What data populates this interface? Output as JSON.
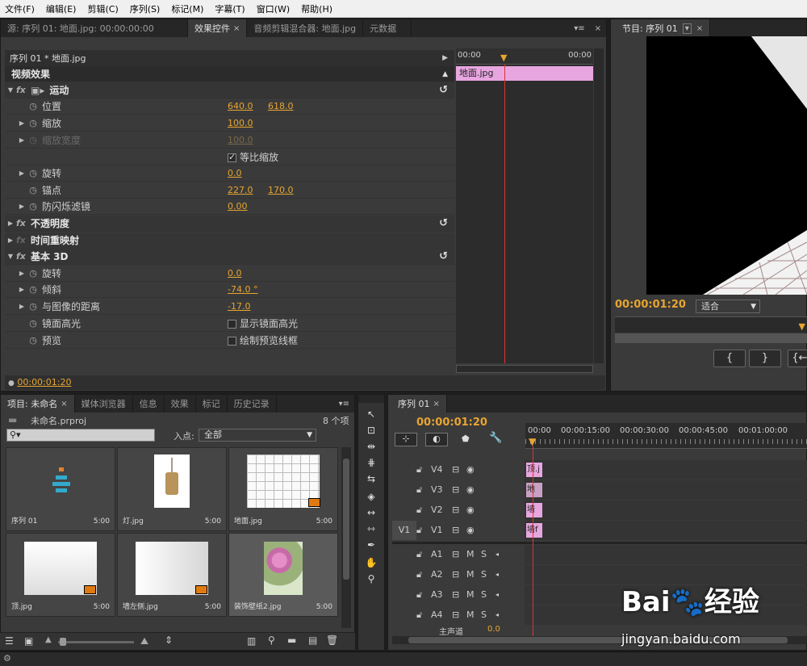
{
  "menu": [
    "文件(F)",
    "编辑(E)",
    "剪辑(C)",
    "序列(S)",
    "标记(M)",
    "字幕(T)",
    "窗口(W)",
    "帮助(H)"
  ],
  "top_tabs": {
    "source": "源: 序列 01: 地面.jpg: 00:00:00:00",
    "effect_controls": "效果控件",
    "audio_mixer": "音频剪辑混合器: 地面.jpg",
    "metadata": "元数据"
  },
  "effect_controls": {
    "clip_header": "序列 01 * 地面.jpg",
    "video_effects": "视频效果",
    "motion": "运动",
    "position_label": "位置",
    "position_x": "640.0",
    "position_y": "618.0",
    "scale_label": "缩放",
    "scale_value": "100.0",
    "scale_width_label": "缩放宽度",
    "scale_width_value": "100.0",
    "uniform_scale_label": "等比缩放",
    "rotation_label": "旋转",
    "rotation_value": "0.0",
    "anchor_label": "锚点",
    "anchor_x": "227.0",
    "anchor_y": "170.0",
    "antiflicker_label": "防闪烁滤镜",
    "antiflicker_value": "0.00",
    "opacity": "不透明度",
    "time_remap": "时间重映射",
    "basic3d": "基本 3D",
    "b3d_rotation_label": "旋转",
    "b3d_rotation_value": "0.0",
    "tilt_label": "倾斜",
    "tilt_value": "-74.0 °",
    "distance_label": "与图像的距离",
    "distance_value": "-17.0",
    "specular_label": "镜面高光",
    "specular_check": "显示镜面高光",
    "preview_label": "预览",
    "preview_check": "绘制预览线框",
    "ruler_start": "00:00",
    "ruler_end": "00:00",
    "clip_name": "地面.jpg",
    "timecode": "00:00:01:20"
  },
  "program": {
    "tab": "节目: 序列 01",
    "timecode": "00:00:01:20",
    "fit": "适合"
  },
  "project": {
    "tabs": [
      "项目: 未命名",
      "媒体浏览器",
      "信息",
      "效果",
      "标记",
      "历史记录"
    ],
    "file": "未命名.prproj",
    "count": "8 个项",
    "search_placeholder": "",
    "in_point_label": "入点:",
    "in_point_value": "全部",
    "items": [
      {
        "name": "序列 01",
        "dur": "5:00"
      },
      {
        "name": "灯.jpg",
        "dur": "5:00"
      },
      {
        "name": "地面.jpg",
        "dur": "5:00"
      },
      {
        "name": "顶.jpg",
        "dur": "5:00"
      },
      {
        "name": "墙左侧.jpg",
        "dur": "5:00"
      },
      {
        "name": "装饰壁纸2.jpg",
        "dur": "5:00"
      }
    ]
  },
  "timeline": {
    "tab": "序列 01",
    "timecode": "00:00:01:20",
    "ruler": [
      "00:00",
      "00:00:15:00",
      "00:00:30:00",
      "00:00:45:00",
      "00:01:00:00"
    ],
    "video_tracks": [
      {
        "name": "V4",
        "clip": "顶.j"
      },
      {
        "name": "V3",
        "clip": "地面"
      },
      {
        "name": "V2",
        "clip": "墙左"
      },
      {
        "name": "V1",
        "clip": "墙f"
      }
    ],
    "source_v1": "V1",
    "audio_tracks": [
      "A1",
      "A2",
      "A3",
      "A4"
    ],
    "master": "主声道",
    "master_value": "0.0"
  },
  "watermark": {
    "brand": "Bai",
    "brand2": "经验",
    "url": "jingyan.baidu.com"
  }
}
